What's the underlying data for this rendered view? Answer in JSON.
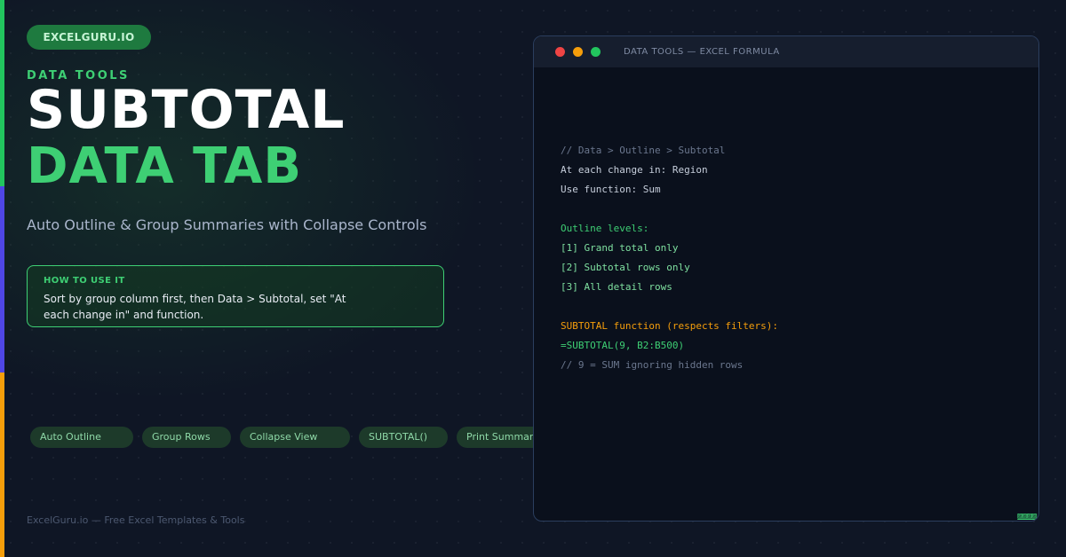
{
  "brand": {
    "label": "EXCELGURU.IO"
  },
  "hero": {
    "eyebrow": "DATA TOOLS",
    "title_line1": "SUBTOTAL",
    "title_line2": "DATA TAB",
    "subtitle": "Auto Outline & Group Summaries with Collapse Controls"
  },
  "howto": {
    "title": "HOW TO USE IT",
    "body": "Sort by group column first, then Data > Subtotal, set \"At each change in\" and function."
  },
  "tags": [
    {
      "label": "Auto Outline"
    },
    {
      "label": "Group Rows"
    },
    {
      "label": "Collapse View"
    },
    {
      "label": "SUBTOTAL()"
    },
    {
      "label": "Print Summary"
    }
  ],
  "footer": {
    "text": "ExcelGuru.io — Free Excel Templates & Tools"
  },
  "terminal": {
    "title": "DATA TOOLS — EXCEL FORMULA",
    "lines": [
      {
        "text": "// Data > Outline > Subtotal",
        "style": "comment"
      },
      {
        "text": "At each change in: Region",
        "style": "text"
      },
      {
        "text": "Use function: Sum",
        "style": "text"
      },
      {
        "text": "",
        "style": "text"
      },
      {
        "text": "Outline levels:",
        "style": "green"
      },
      {
        "text": "[1] Grand total only",
        "style": "green2"
      },
      {
        "text": "[2] Subtotal rows only",
        "style": "green2"
      },
      {
        "text": "[3] All detail rows",
        "style": "green2"
      },
      {
        "text": "",
        "style": "text"
      },
      {
        "text": "SUBTOTAL function (respects filters):",
        "style": "orange"
      },
      {
        "text": "=SUBTOTAL(9, B2:B500)",
        "style": "green"
      },
      {
        "text": "// 9 = SUM ignoring hidden rows",
        "style": "comment"
      }
    ],
    "corner_mark": "▨▨▨▨"
  },
  "colors": {
    "accent_green": "#22c55e",
    "accent_blue": "#4f46e5",
    "accent_orange": "#f59e0b",
    "background": "#0f1625"
  }
}
